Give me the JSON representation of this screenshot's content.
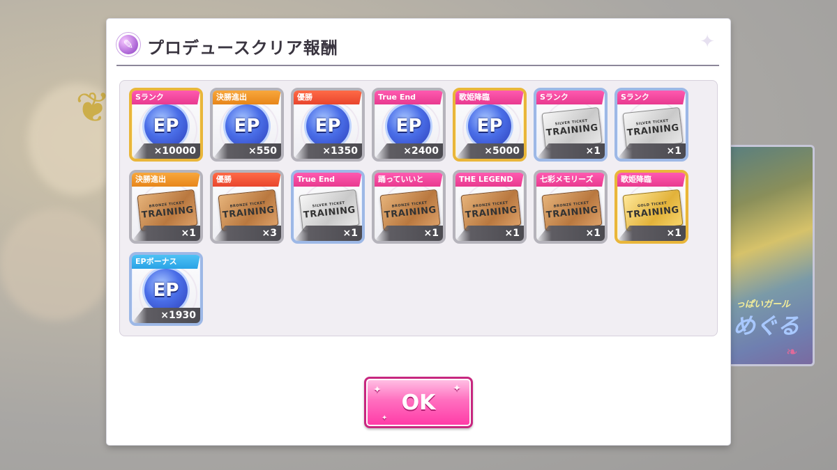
{
  "dialog": {
    "title": "プロデュースクリア報酬",
    "ok_label": "OK"
  },
  "background": {
    "card_caption": "っぱいガール",
    "card_name": "めぐる"
  },
  "rewards": [
    {
      "label": "Sランク",
      "label_color": "pink",
      "frame": "gold",
      "item": "ep",
      "qty": "×10000"
    },
    {
      "label": "決勝進出",
      "label_color": "orange",
      "frame": "silver",
      "item": "ep",
      "qty": "×550"
    },
    {
      "label": "優勝",
      "label_color": "red",
      "frame": "silver",
      "item": "ep",
      "qty": "×1350"
    },
    {
      "label": "True End",
      "label_color": "pink",
      "frame": "silver",
      "item": "ep",
      "qty": "×2400"
    },
    {
      "label": "歌姫降臨",
      "label_color": "pink",
      "frame": "gold",
      "item": "ep",
      "qty": "×5000"
    },
    {
      "label": "Sランク",
      "label_color": "pink",
      "frame": "blue",
      "item": "ticket",
      "ticket_type": "silver",
      "ticket_sub": "SILVER TICKET",
      "ticket_main": "TRAINING",
      "qty": "×1"
    },
    {
      "label": "Sランク",
      "label_color": "pink",
      "frame": "blue",
      "item": "ticket",
      "ticket_type": "silver",
      "ticket_sub": "SILVER TICKET",
      "ticket_main": "TRAINING",
      "qty": "×1"
    },
    {
      "label": "決勝進出",
      "label_color": "orange",
      "frame": "silver",
      "item": "ticket",
      "ticket_type": "bronze",
      "ticket_sub": "BRONZE TICKET",
      "ticket_main": "TRAINING",
      "qty": "×1"
    },
    {
      "label": "優勝",
      "label_color": "red",
      "frame": "silver",
      "item": "ticket",
      "ticket_type": "bronze",
      "ticket_sub": "BRONZE TICKET",
      "ticket_main": "TRAINING",
      "qty": "×3"
    },
    {
      "label": "True End",
      "label_color": "pink",
      "frame": "blue",
      "item": "ticket",
      "ticket_type": "silver",
      "ticket_sub": "SILVER TICKET",
      "ticket_main": "TRAINING",
      "qty": "×1"
    },
    {
      "label": "踊っていいと",
      "label_color": "pink",
      "frame": "silver",
      "item": "ticket",
      "ticket_type": "bronze",
      "ticket_sub": "BRONZE TICKET",
      "ticket_main": "TRAINING",
      "qty": "×1"
    },
    {
      "label": "THE LEGEND",
      "label_color": "pink",
      "frame": "silver",
      "item": "ticket",
      "ticket_type": "bronze",
      "ticket_sub": "BRONZE TICKET",
      "ticket_main": "TRAINING",
      "qty": "×1"
    },
    {
      "label": "七彩メモリーズ",
      "label_color": "pink",
      "frame": "silver",
      "item": "ticket",
      "ticket_type": "bronze",
      "ticket_sub": "BRONZE TICKET",
      "ticket_main": "TRAINING",
      "qty": "×1"
    },
    {
      "label": "歌姫降臨",
      "label_color": "pink",
      "frame": "gold",
      "item": "ticket",
      "ticket_type": "gold",
      "ticket_sub": "GOLD TICKET",
      "ticket_main": "TRAINING",
      "qty": "×1"
    },
    {
      "label": "EPボーナス",
      "label_color": "cyan",
      "frame": "blue",
      "item": "ep",
      "qty": "×1930"
    }
  ],
  "icons": {
    "title": "feather-badge-icon",
    "ep": "ep-coin-icon",
    "ticket": "training-ticket-icon",
    "sparkle": "sparkle-icon"
  },
  "colors": {
    "label_pink": "#e83a8f",
    "label_orange": "#e7861a",
    "label_red": "#e8452d",
    "label_cyan": "#2aa3e6",
    "ok_button": "#ff3aa6"
  }
}
